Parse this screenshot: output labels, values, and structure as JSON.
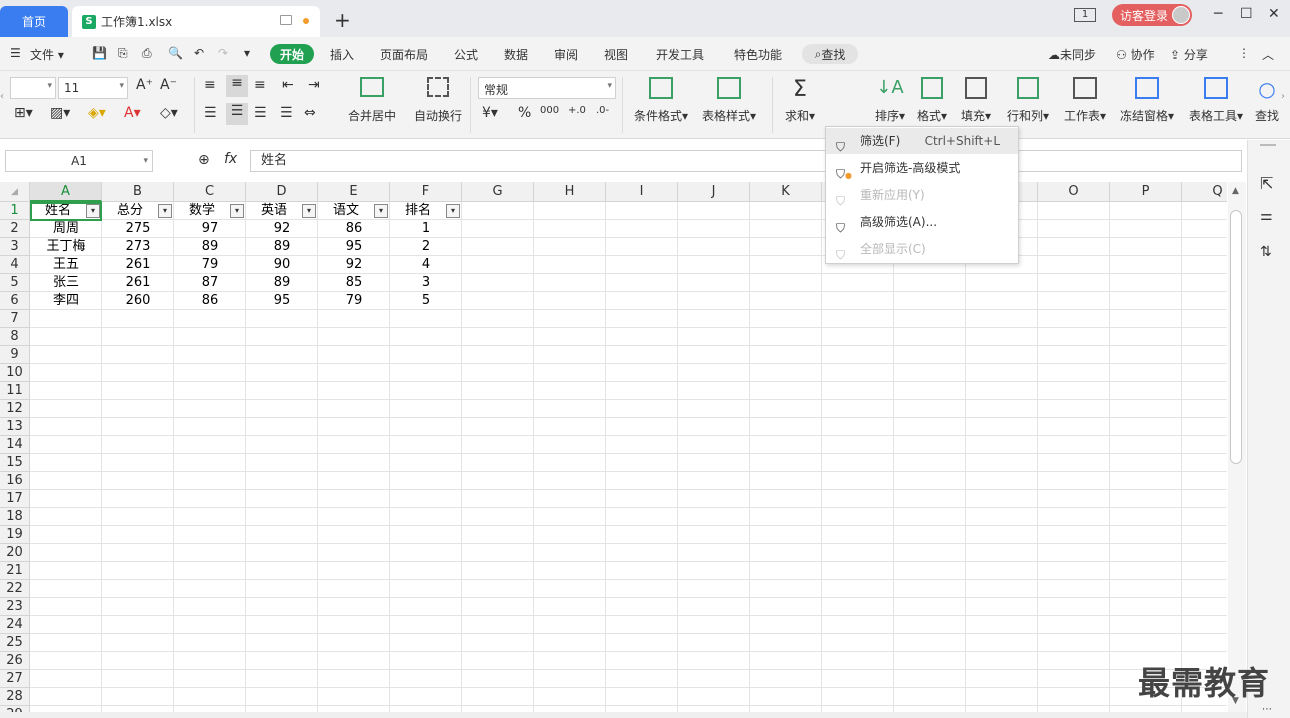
{
  "tabs": {
    "home": "首页",
    "file": "工作簿1.xlsx",
    "file_icon": "S",
    "new_tab": "+"
  },
  "title_controls": {
    "page_badge": "1",
    "login": "访客登录",
    "minimize": "─",
    "maximize": "☐",
    "close": "✕"
  },
  "menu": {
    "file": "文件",
    "items": [
      "开始",
      "插入",
      "页面布局",
      "公式",
      "数据",
      "审阅",
      "视图",
      "开发工具",
      "特色功能"
    ],
    "search": "查找",
    "sync": "未同步",
    "collab": "协作",
    "share": "分享"
  },
  "ribbon": {
    "font_size": "11",
    "number_format": "常规",
    "merge_center": "合并居中",
    "auto_wrap": "自动换行",
    "currency": "¥",
    "percent": "%",
    "thousands": "000",
    "cond_format": "条件格式",
    "table_style": "表格样式",
    "sum": "求和",
    "filter": "筛选",
    "sort": "排序",
    "format": "格式",
    "fill": "填充",
    "row_col": "行和列",
    "worksheet": "工作表",
    "freeze": "冻结窗格",
    "table_tools": "表格工具",
    "find": "查找"
  },
  "formula_bar": {
    "cell_ref": "A1",
    "fx": "fx",
    "value": "姓名"
  },
  "grid": {
    "columns": [
      "A",
      "B",
      "C",
      "D",
      "E",
      "F",
      "G",
      "H",
      "I",
      "J",
      "K",
      "L",
      "M",
      "N",
      "O",
      "P",
      "Q"
    ],
    "rows": [
      "1",
      "2",
      "3",
      "4",
      "5",
      "6",
      "7",
      "8",
      "9",
      "10",
      "11",
      "12",
      "13",
      "14",
      "15",
      "16",
      "17",
      "18",
      "19",
      "20",
      "21",
      "22",
      "23",
      "24",
      "25",
      "26",
      "27",
      "28",
      "29"
    ],
    "headers": [
      "姓名",
      "总分",
      "数学",
      "英语",
      "语文",
      "排名"
    ],
    "data": [
      [
        "周周",
        "275",
        "97",
        "92",
        "86",
        "1"
      ],
      [
        "王丁梅",
        "273",
        "89",
        "89",
        "95",
        "2"
      ],
      [
        "王五",
        "261",
        "79",
        "90",
        "92",
        "4"
      ],
      [
        "张三",
        "261",
        "87",
        "89",
        "85",
        "3"
      ],
      [
        "李四",
        "260",
        "86",
        "95",
        "79",
        "5"
      ]
    ]
  },
  "dropdown": {
    "items": [
      {
        "label": "筛选(F)",
        "shortcut": "Ctrl+Shift+L"
      },
      {
        "label": "开启筛选-高级模式",
        "shortcut": ""
      },
      {
        "label": "重新应用(Y)",
        "shortcut": ""
      },
      {
        "label": "高级筛选(A)...",
        "shortcut": ""
      },
      {
        "label": "全部显示(C)",
        "shortcut": ""
      }
    ]
  },
  "watermark": "最需教育"
}
